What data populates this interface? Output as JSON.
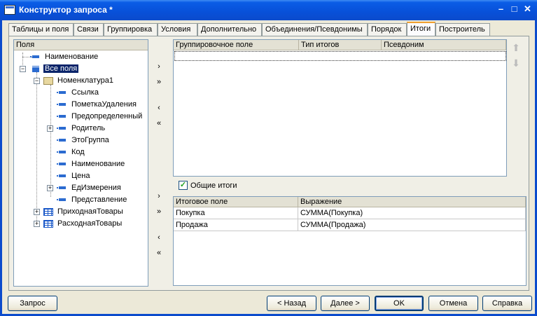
{
  "window": {
    "title": "Конструктор запроса *",
    "controls": {
      "minimize": "–",
      "maximize": "□",
      "close": "✕"
    }
  },
  "tabs": [
    {
      "label": "Таблицы и поля",
      "active": false
    },
    {
      "label": "Связи",
      "active": false
    },
    {
      "label": "Группировка",
      "active": false
    },
    {
      "label": "Условия",
      "active": false
    },
    {
      "label": "Дополнительно",
      "active": false
    },
    {
      "label": "Объединения/Псевдонимы",
      "active": false
    },
    {
      "label": "Порядок",
      "active": false
    },
    {
      "label": "Итоги",
      "active": true
    },
    {
      "label": "Построитель",
      "active": false
    }
  ],
  "fields_panel": {
    "header": "Поля",
    "items": [
      {
        "label": "Наименование",
        "level": 0,
        "icon": "field-icon",
        "expandable": false,
        "selected": false
      },
      {
        "label": "Все поля",
        "level": 0,
        "icon": "all-fields-icon",
        "expandable": true,
        "expanded": true,
        "selected": true
      },
      {
        "label": "Номенклатура1",
        "level": 1,
        "icon": "folder-icon",
        "expandable": true,
        "expanded": true,
        "selected": false
      },
      {
        "label": "Ссылка",
        "level": 2,
        "icon": "field-icon",
        "expandable": false
      },
      {
        "label": "ПометкаУдаления",
        "level": 2,
        "icon": "field-icon",
        "expandable": false
      },
      {
        "label": "Предопределенный",
        "level": 2,
        "icon": "field-icon",
        "expandable": false
      },
      {
        "label": "Родитель",
        "level": 2,
        "icon": "field-icon",
        "expandable": true,
        "expanded": false
      },
      {
        "label": "ЭтоГруппа",
        "level": 2,
        "icon": "field-icon",
        "expandable": false
      },
      {
        "label": "Код",
        "level": 2,
        "icon": "field-icon",
        "expandable": false
      },
      {
        "label": "Наименование",
        "level": 2,
        "icon": "field-icon",
        "expandable": false
      },
      {
        "label": "Цена",
        "level": 2,
        "icon": "field-icon",
        "expandable": false
      },
      {
        "label": "ЕдИзмерения",
        "level": 2,
        "icon": "field-icon",
        "expandable": true,
        "expanded": false
      },
      {
        "label": "Представление",
        "level": 2,
        "icon": "field-icon",
        "expandable": false
      },
      {
        "label": "ПриходнаяТовары",
        "level": 1,
        "icon": "table-icon",
        "expandable": true,
        "expanded": false
      },
      {
        "label": "РасходнаяТовары",
        "level": 1,
        "icon": "table-icon",
        "expandable": true,
        "expanded": false
      }
    ]
  },
  "move_buttons_top": [
    "›",
    "»",
    "‹",
    "«"
  ],
  "move_buttons_bottom": [
    "›",
    "»",
    "‹",
    "«"
  ],
  "grouping_grid": {
    "columns": [
      "Группировочное поле",
      "Тип итогов",
      "Псевдоним"
    ],
    "rows": []
  },
  "general_totals": {
    "label": "Общие итоги",
    "checked": true
  },
  "totals_grid": {
    "columns": [
      "Итоговое поле",
      "Выражение"
    ],
    "rows": [
      [
        "Покупка",
        "СУММА(Покупка)"
      ],
      [
        "Продажа",
        "СУММА(Продажа)"
      ]
    ]
  },
  "order_arrows": {
    "up": "⬆",
    "down": "⬇"
  },
  "footer_buttons": {
    "query": "Запрос",
    "back": "< Назад",
    "next": "Далее >",
    "ok": "OK",
    "cancel": "Отмена",
    "help": "Справка"
  }
}
